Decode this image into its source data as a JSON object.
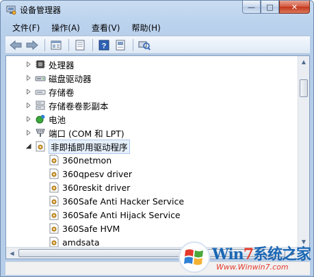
{
  "window": {
    "title": "设备管理器",
    "buttons": {
      "minimize": "—",
      "maximize": "□",
      "close": "✕"
    }
  },
  "menu": [
    "文件(F)",
    "操作(A)",
    "查看(V)",
    "帮助(H)"
  ],
  "toolbar": [
    "back-arrow-icon",
    "forward-arrow-icon",
    "properties-icon",
    "update-icon",
    "help-icon",
    "device-icon",
    "scan-hardware-icon"
  ],
  "tree": {
    "categories": [
      {
        "label": "处理器",
        "icon": "processor-icon",
        "expanded": false
      },
      {
        "label": "磁盘驱动器",
        "icon": "disk-drive-icon",
        "expanded": false
      },
      {
        "label": "存储卷",
        "icon": "storage-volume-icon",
        "expanded": false
      },
      {
        "label": "存储卷卷影副本",
        "icon": "shadow-copy-icon",
        "expanded": false
      },
      {
        "label": "电池",
        "icon": "battery-icon",
        "expanded": false
      },
      {
        "label": "端口 (COM 和 LPT)",
        "icon": "port-icon",
        "expanded": false
      },
      {
        "label": "非即插即用驱动程序",
        "icon": "non-pnp-driver-icon",
        "expanded": true
      }
    ],
    "children": [
      "360netmon",
      "360qpesv driver",
      "360reskit driver",
      "360Safe Anti Hacker Service",
      "360Safe Anti Hijack Service",
      "360Safe HVM",
      "amdsata"
    ]
  },
  "watermark": {
    "brand_prefix": "Win",
    "brand_seven": "7",
    "brand_suffix": "系统之家",
    "url": "Www.Winwin7.com"
  },
  "colors": {
    "window_frame": "#b6cde9",
    "close_button": "#c2361c",
    "selection_border": "#aec7e8",
    "watermark_blue": "#1a67b4",
    "watermark_red": "#e23a2c"
  }
}
